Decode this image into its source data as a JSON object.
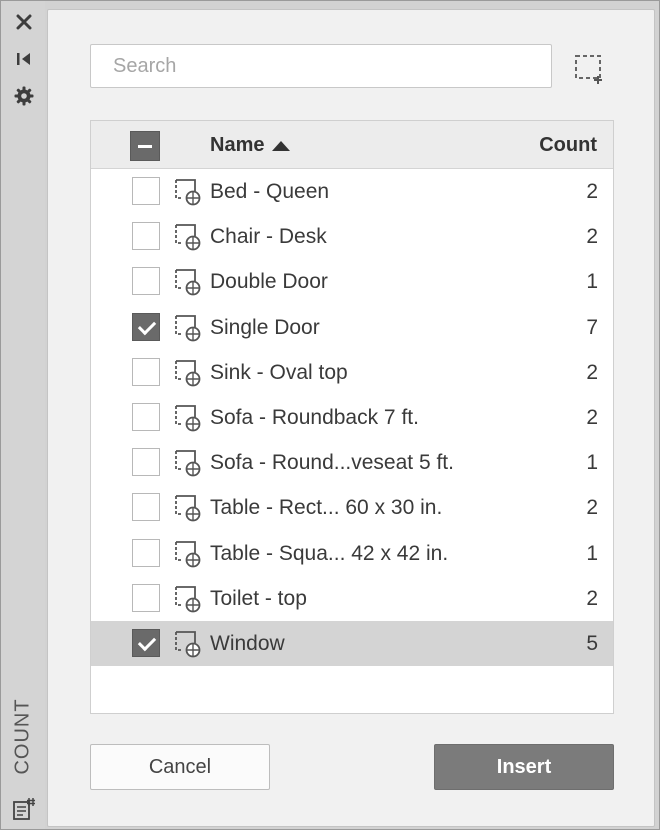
{
  "sidebar": {
    "title": "COUNT",
    "icons": [
      "close-icon",
      "collapse-icon",
      "gear-icon",
      "count-table-icon"
    ]
  },
  "search": {
    "placeholder": "Search",
    "value": ""
  },
  "table": {
    "columns": {
      "name": "Name",
      "count": "Count"
    },
    "sort": "name-ascending",
    "rows": [
      {
        "name": "Bed - Queen",
        "count": "2",
        "checked": false,
        "selected": false
      },
      {
        "name": "Chair - Desk",
        "count": "2",
        "checked": false,
        "selected": false
      },
      {
        "name": "Double Door",
        "count": "1",
        "checked": false,
        "selected": false
      },
      {
        "name": "Single Door",
        "count": "7",
        "checked": true,
        "selected": false
      },
      {
        "name": "Sink - Oval top",
        "count": "2",
        "checked": false,
        "selected": false
      },
      {
        "name": "Sofa - Roundback 7 ft.",
        "count": "2",
        "checked": false,
        "selected": false
      },
      {
        "name": "Sofa - Round...veseat 5 ft.",
        "count": "1",
        "checked": false,
        "selected": false
      },
      {
        "name": "Table - Rect... 60 x 30 in.",
        "count": "2",
        "checked": false,
        "selected": false
      },
      {
        "name": "Table - Squa... 42 x 42 in.",
        "count": "1",
        "checked": false,
        "selected": false
      },
      {
        "name": "Toilet - top",
        "count": "2",
        "checked": false,
        "selected": false
      },
      {
        "name": "Window",
        "count": "5",
        "checked": true,
        "selected": true
      }
    ]
  },
  "buttons": {
    "cancel": "Cancel",
    "insert": "Insert"
  },
  "colors": {
    "checked_fill": "#6a6a6a",
    "selected_row": "#d4d4d4",
    "insert_button": "#7b7b7b"
  }
}
